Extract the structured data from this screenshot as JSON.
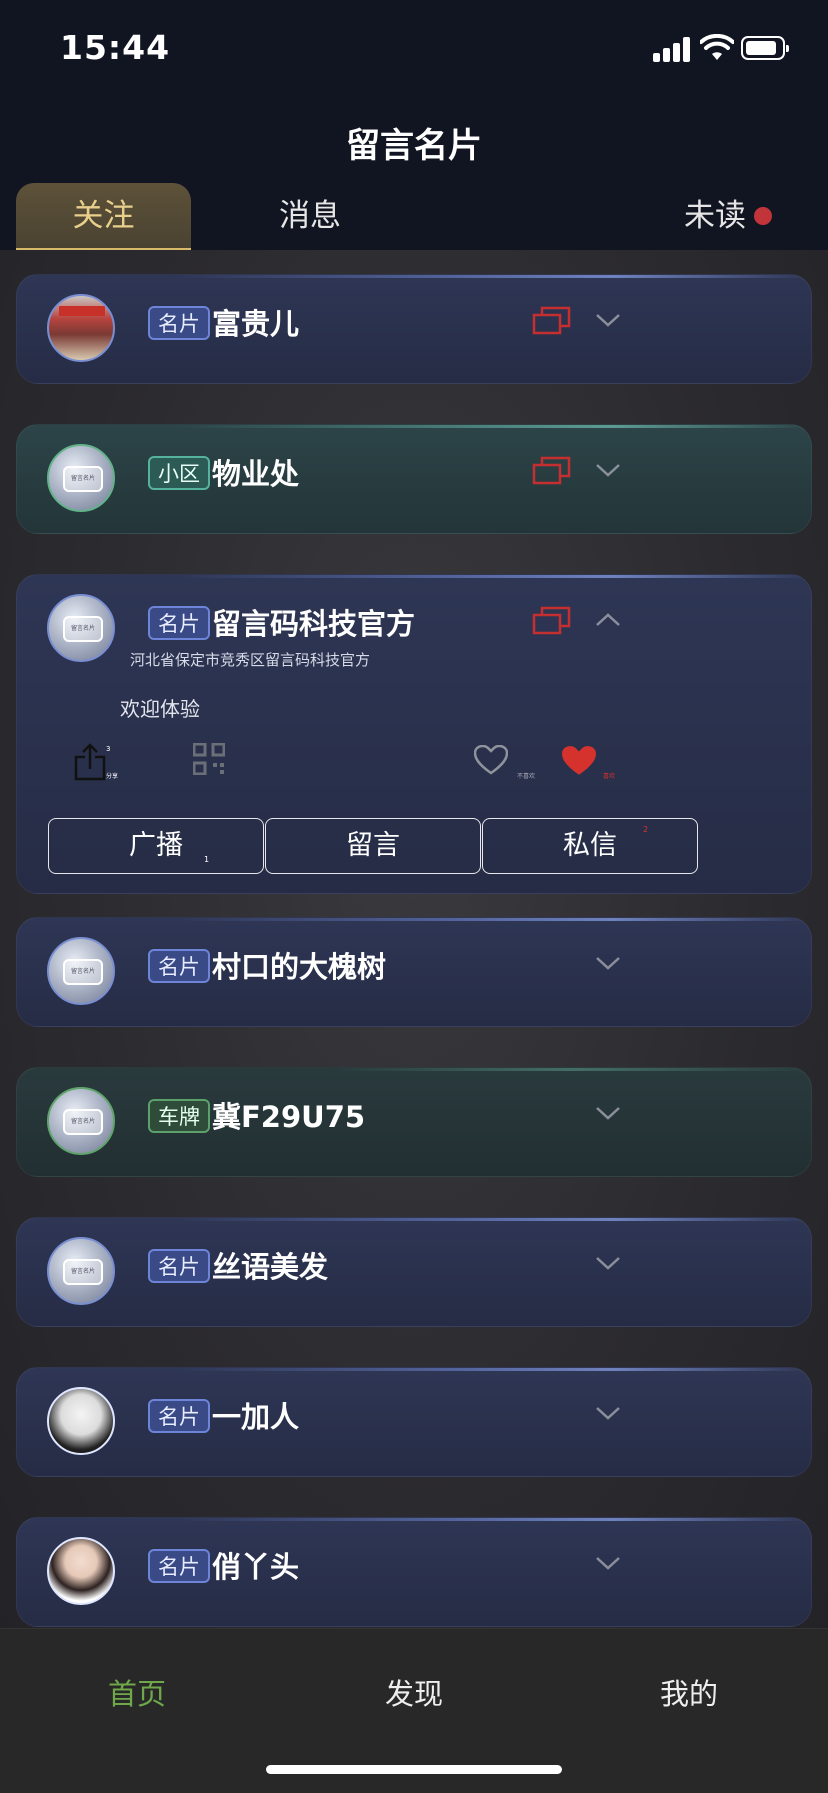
{
  "status": {
    "time": "15:44"
  },
  "header": {
    "title": "留言名片"
  },
  "tabs": {
    "follow": "关注",
    "messages": "消息",
    "unread": "未读"
  },
  "cards": [
    {
      "tag": "名片",
      "name": "富贵儿",
      "theme": "blue",
      "avatar": "shop-photo",
      "copy_icon": true,
      "expanded": false
    },
    {
      "tag": "小区",
      "name": "物业处",
      "theme": "teal",
      "avatar": "default-logo",
      "copy_icon": true,
      "expanded": false
    },
    {
      "tag": "名片",
      "name": "留言码科技官方",
      "theme": "blue",
      "avatar": "default-logo",
      "copy_icon": true,
      "expanded": true,
      "address": "河北省保定市竞秀区留言码科技官方",
      "description": "欢迎体验",
      "share_count": "3",
      "share_label": "分享",
      "dislike_label": "不喜欢",
      "like_label": "喜欢",
      "buttons": {
        "broadcast": "广播",
        "broadcast_count": "1",
        "leave_message": "留言",
        "private_message": "私信",
        "private_message_count": "2"
      }
    },
    {
      "tag": "名片",
      "name": "村口的大槐树",
      "theme": "blue",
      "avatar": "default-logo",
      "copy_icon": false,
      "expanded": false
    },
    {
      "tag": "车牌",
      "name": "冀F29U75",
      "theme": "dark-teal",
      "avatar": "default-logo",
      "copy_icon": false,
      "expanded": false
    },
    {
      "tag": "名片",
      "name": "丝语美发",
      "theme": "blue",
      "avatar": "default-logo",
      "copy_icon": false,
      "expanded": false
    },
    {
      "tag": "名片",
      "name": "一加人",
      "theme": "blue",
      "avatar": "anime-girl",
      "copy_icon": false,
      "expanded": false
    },
    {
      "tag": "名片",
      "name": "俏丫头",
      "theme": "blue",
      "avatar": "woman-photo",
      "copy_icon": false,
      "expanded": false
    }
  ],
  "avatar_logo_text": "留言名片",
  "bottom_nav": {
    "home": "首页",
    "discover": "发现",
    "mine": "我的"
  },
  "colors": {
    "accent_gold": "#e8cf8c",
    "active_green": "#6fa84a",
    "alert_red": "#c1343a"
  },
  "icons": [
    "signal-icon",
    "wifi-icon",
    "battery-icon",
    "copy-icon",
    "chevron-down-icon",
    "chevron-up-icon",
    "share-icon",
    "qr-code-icon",
    "heart-outline-icon",
    "heart-filled-icon"
  ]
}
